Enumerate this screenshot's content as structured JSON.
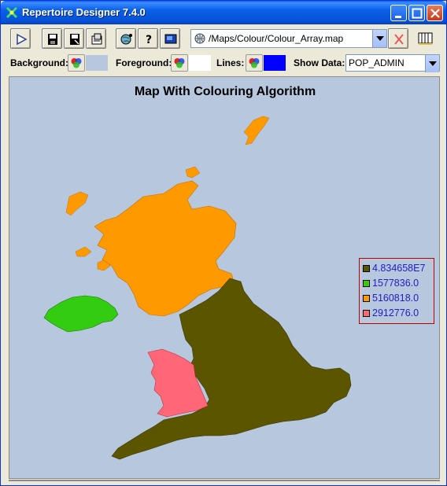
{
  "window": {
    "title": "Repertoire Designer 7.4.0"
  },
  "toolbar": {
    "path": "/Maps/Colour/Colour_Array.map",
    "buttons": [
      "run-icon",
      "save-icon",
      "save-as-icon",
      "export-icon",
      "globe-settings-icon",
      "help-icon",
      "screen-icon",
      "clear-icon",
      "panels-icon"
    ]
  },
  "options": {
    "background_label": "Background:",
    "foreground_label": "Foreground:",
    "lines_label": "Lines:",
    "show_data_label": "Show Data:",
    "show_data_value": "POP_ADMIN",
    "background_color": "#b6c7de",
    "foreground_color": "#ffffff",
    "lines_color": "#0000ff"
  },
  "map": {
    "title": "Map With Colouring Algorithm",
    "background_color": "#b6c7de",
    "regions": [
      {
        "name": "scotland",
        "color": "#ff9900",
        "value": "5160818.0"
      },
      {
        "name": "northern-ireland",
        "color": "#33cc11",
        "value": "1577836.0"
      },
      {
        "name": "wales",
        "color": "#ff6677",
        "value": "2912776.0"
      },
      {
        "name": "england",
        "color": "#5c5500",
        "value": "4.834658E7"
      }
    ],
    "legend": [
      {
        "label": "4.834658E7",
        "color": "#5c5500"
      },
      {
        "label": "1577836.0",
        "color": "#33cc11"
      },
      {
        "label": "5160818.0",
        "color": "#ff9900"
      },
      {
        "label": "2912776.0",
        "color": "#ff6677"
      }
    ]
  }
}
